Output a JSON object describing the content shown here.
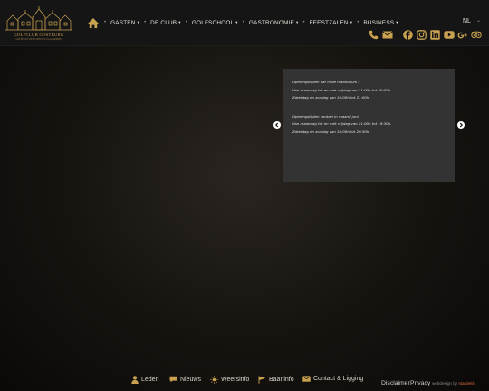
{
  "brand": {
    "name": "GOLFCLUB OOSTBURG",
    "tagline": "GOLFEN IN WEST ZEEUWS-VLAANDEREN",
    "accent_color": "#c9a24f"
  },
  "nav": {
    "home_icon": "home-icon",
    "items": [
      {
        "label": "GASTEN",
        "caret": "▾"
      },
      {
        "label": "DE CLUB",
        "caret": "▾"
      },
      {
        "label": "GOLFSCHOOL",
        "caret": "▾"
      },
      {
        "label": "GASTRONOMIE",
        "caret": "▾"
      },
      {
        "label": "FEESTZALEN",
        "caret": "▾"
      },
      {
        "label": "BUSINESS",
        "caret": "▾"
      }
    ],
    "separator": "•",
    "language": "NL",
    "language_caret": "⌄"
  },
  "contact_icons": [
    "phone-icon",
    "mail-icon"
  ],
  "social_icons": [
    "facebook-icon",
    "instagram-icon",
    "linkedin-icon",
    "youtube-icon",
    "google-plus-icon",
    "tripadvisor-icon"
  ],
  "slider": {
    "lines_block1": [
      "Openingstijden bar in de maand juni :",
      "Van maandag tot en met vrijdag van 11:00h tot 20:00h.",
      "Zaterdag en zondag van 10:00h tot 21:00h."
    ],
    "lines_block2": [
      "Openingstijden keuken in maand juni :",
      "Van maandag tot en met vrijdag van 11:00h tot 19:30h.",
      "Zaterdag en zondag van 10:00h tot 20:30h."
    ],
    "prev_icon": "chevron-left-icon",
    "next_icon": "chevron-right-icon"
  },
  "footer": {
    "links": [
      {
        "label": "Leden",
        "icon": "user-icon"
      },
      {
        "label": "Nieuws",
        "icon": "chat-icon"
      },
      {
        "label": "Weersinfo",
        "icon": "sun-icon"
      },
      {
        "label": "Baaninfo",
        "icon": "flag-icon"
      },
      {
        "label": "Contact & Ligging",
        "icon": "envelope-icon"
      }
    ],
    "disclaimer": "Disclaimer",
    "privacy": "Privacy",
    "credit_prefix": "webdesign by",
    "credit_brand": "stardekk"
  }
}
